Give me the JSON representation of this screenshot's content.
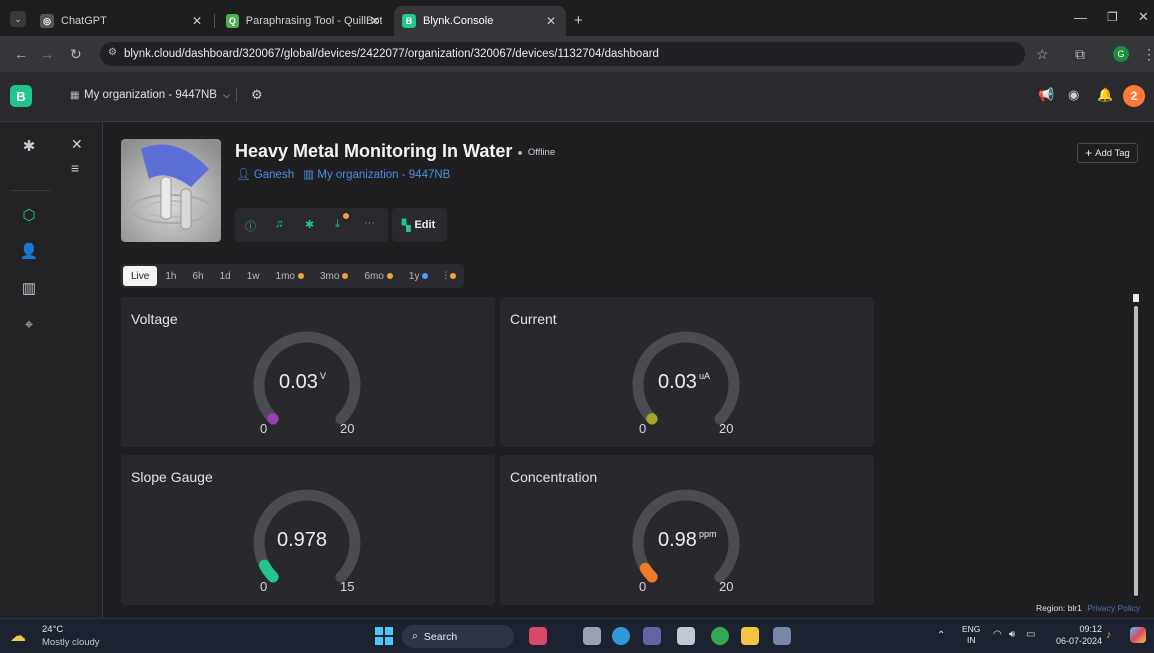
{
  "browser": {
    "tabs": [
      {
        "label": "ChatGPT",
        "active": false
      },
      {
        "label": "Paraphrasing Tool - QuillBot AI",
        "active": false
      },
      {
        "label": "Blynk.Console",
        "active": true
      }
    ],
    "url": "blynk.cloud/dashboard/320067/global/devices/2422077/organization/320067/devices/1132704/dashboard",
    "profile_initial": "G"
  },
  "app": {
    "logo_letter": "B",
    "org_selector": "My organization - 9447NB",
    "avatar_initial": "2"
  },
  "device": {
    "name": "Heavy Metal Monitoring In Water",
    "status": "Offline",
    "owner": "Ganesh",
    "organization": "My organization - 9447NB",
    "edit_label": "Edit",
    "add_tag_label": "Add Tag"
  },
  "time_ranges": [
    {
      "label": "Live",
      "active": true,
      "dot": null
    },
    {
      "label": "1h",
      "active": false,
      "dot": null
    },
    {
      "label": "6h",
      "active": false,
      "dot": null
    },
    {
      "label": "1d",
      "active": false,
      "dot": null
    },
    {
      "label": "1w",
      "active": false,
      "dot": null
    },
    {
      "label": "1mo",
      "active": false,
      "dot": "#f0a040"
    },
    {
      "label": "3mo",
      "active": false,
      "dot": "#f0a040"
    },
    {
      "label": "6mo",
      "active": false,
      "dot": "#f0a040"
    },
    {
      "label": "1y",
      "active": false,
      "dot": "#4ea3ff"
    }
  ],
  "widgets": [
    {
      "title": "Voltage",
      "value": "0.03",
      "unit": "V",
      "min": "0",
      "max": "20",
      "color": "#9b3fb5",
      "fraction": 0.0015
    },
    {
      "title": "Current",
      "value": "0.03",
      "unit": "uA",
      "min": "0",
      "max": "20",
      "color": "#a3a626",
      "fraction": 0.0015
    },
    {
      "title": "Slope Gauge",
      "value": "0.978",
      "unit": "",
      "min": "0",
      "max": "15",
      "color": "#25c48e",
      "fraction": 0.065
    },
    {
      "title": "Concentration",
      "value": "0.98",
      "unit": "ppm",
      "min": "0",
      "max": "20",
      "color": "#f07a26",
      "fraction": 0.049
    }
  ],
  "footer": {
    "region_label": "Region:",
    "region_value": "blr1",
    "privacy_policy": "Privacy Policy"
  },
  "taskbar": {
    "temperature": "24°C",
    "weather": "Mostly cloudy",
    "search_label": "Search",
    "lang_top": "ENG",
    "lang_bottom": "IN",
    "time": "09:12",
    "date": "06-07-2024"
  }
}
